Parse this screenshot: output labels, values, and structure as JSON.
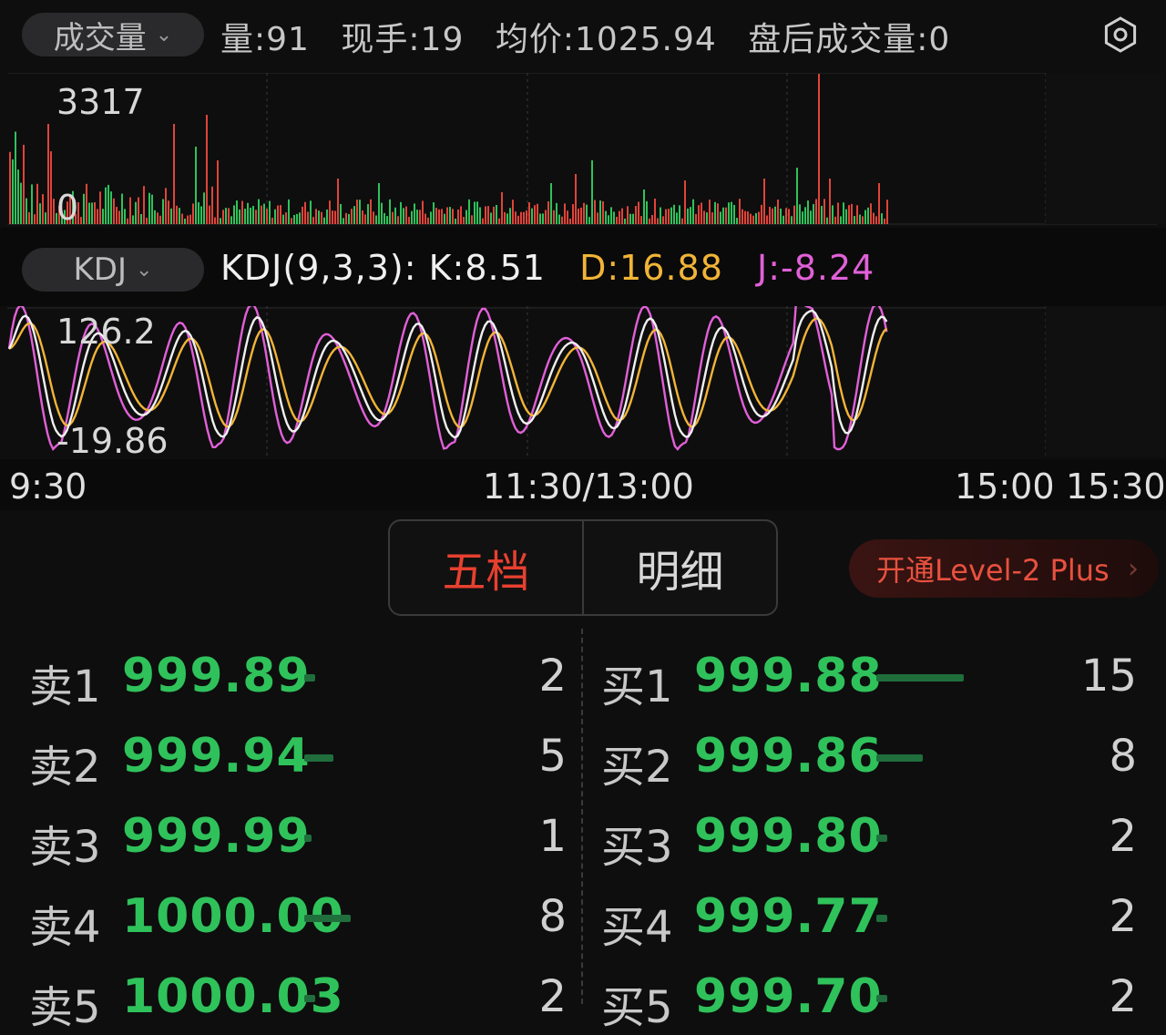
{
  "header": {
    "indicator_label": "成交量",
    "stats": [
      "量:91",
      "现手:19",
      "均价:1025.94",
      "盘后成交量:0"
    ],
    "settings_icon": "gear-icon"
  },
  "volume_chart": {
    "max_label": "3317",
    "min_label": "0"
  },
  "kdj": {
    "indicator_label": "KDJ",
    "params": "KDJ(9,3,3):",
    "k": "K:8.51",
    "d": "D:16.88",
    "j": "J:-8.24",
    "max_label": "126.2",
    "min_label": "-19.86"
  },
  "time_axis": {
    "open": "9:30",
    "mid": "11:30/13:00",
    "close": "15:00",
    "after": "15:30"
  },
  "tabs": {
    "five_levels": "五档",
    "details": "明细"
  },
  "upgrade_button": {
    "label": "开通Level-2 Plus",
    "arrow": "›"
  },
  "order_book": {
    "asks": [
      {
        "label": "卖1",
        "price": "999.89",
        "qty": "2",
        "size": 0.13
      },
      {
        "label": "卖2",
        "price": "999.94",
        "qty": "5",
        "size": 0.33
      },
      {
        "label": "卖3",
        "price": "999.99",
        "qty": "1",
        "size": 0.07
      },
      {
        "label": "卖4",
        "price": "1000.00",
        "qty": "8",
        "size": 0.53
      },
      {
        "label": "卖5",
        "price": "1000.03",
        "qty": "2",
        "size": 0.13
      }
    ],
    "bids": [
      {
        "label": "买1",
        "price": "999.88",
        "qty": "15",
        "size": 1.0
      },
      {
        "label": "买2",
        "price": "999.86",
        "qty": "8",
        "size": 0.53
      },
      {
        "label": "买3",
        "price": "999.80",
        "qty": "2",
        "size": 0.13
      },
      {
        "label": "买4",
        "price": "999.77",
        "qty": "2",
        "size": 0.13
      },
      {
        "label": "买5",
        "price": "999.70",
        "qty": "2",
        "size": 0.13
      }
    ]
  },
  "colors": {
    "up": "#e0443a",
    "down": "#2fc25b",
    "k": "#f0f0f0",
    "d": "#f2b437",
    "j": "#e160d8"
  }
}
